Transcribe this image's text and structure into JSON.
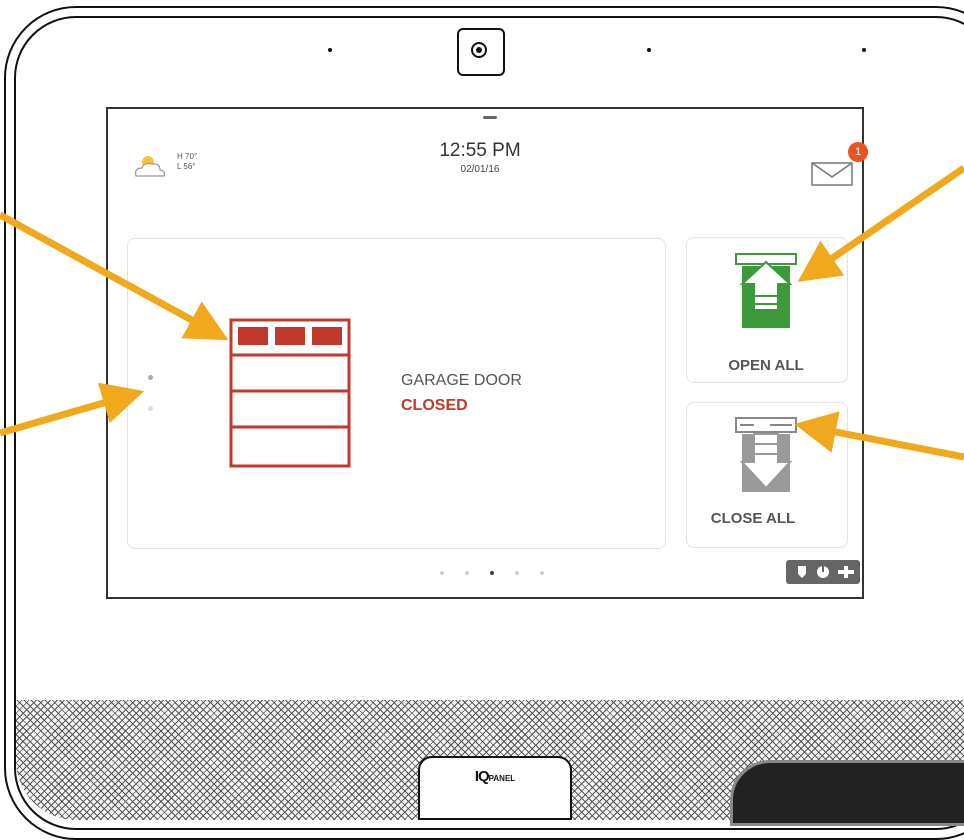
{
  "device": {
    "logo_iq": "IQ",
    "logo_panel": "PANEL"
  },
  "header": {
    "weather_high": "H 70°",
    "weather_low": "L 56°",
    "time": "12:55 PM",
    "date": "02/01/16",
    "message_count": "1"
  },
  "garage": {
    "name": "GARAGE DOOR",
    "status": "CLOSED"
  },
  "actions": {
    "open_all": "OPEN ALL",
    "close_all": "CLOSE ALL"
  },
  "pagination": {
    "total_pages": 5,
    "current_page": 3
  },
  "colors": {
    "arrow": "#f0a81c",
    "closed_status": "#c0392b",
    "open_green": "#3c9a3c",
    "close_gray": "#9a9a9a",
    "badge": "#e8531f"
  },
  "icons": {
    "weather": "partly-cloudy-icon",
    "messages": "envelope-icon",
    "garage": "garage-door-icon",
    "open": "garage-open-icon",
    "close": "garage-close-icon",
    "home_bar": "home-security-icons"
  }
}
